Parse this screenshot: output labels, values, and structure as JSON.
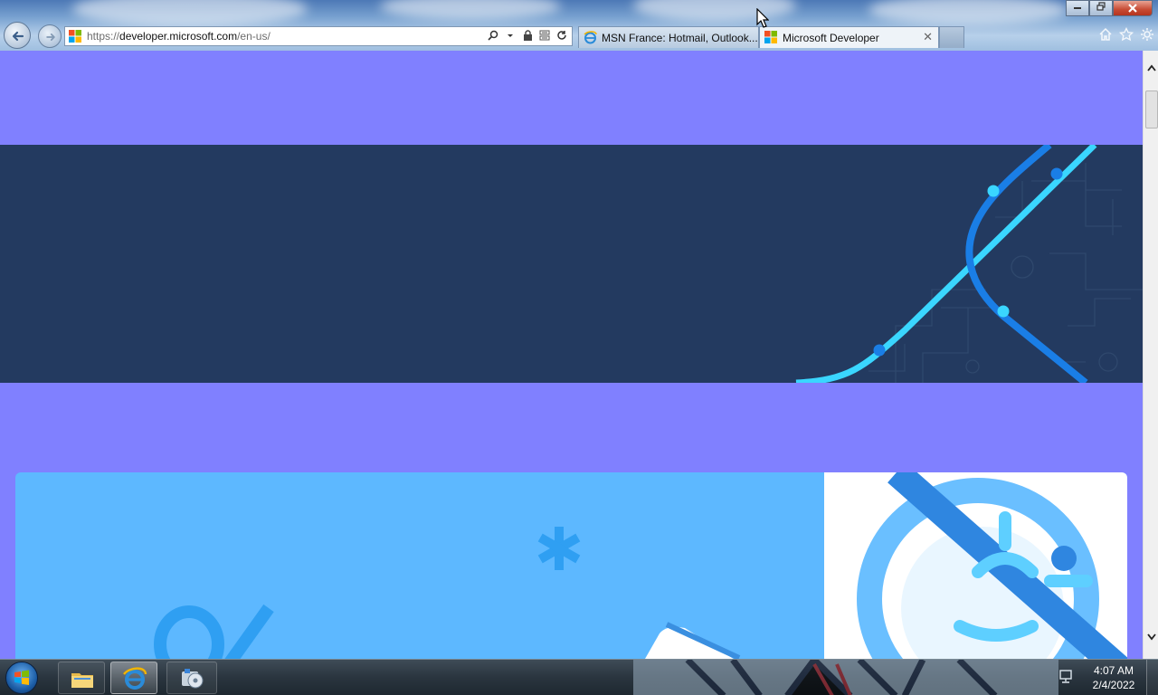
{
  "browser": {
    "url_prefix": "https://",
    "url_host": "developer.microsoft.com",
    "url_path": "/en-us/",
    "tabs": [
      {
        "label": "MSN France: Hotmail, Outlook...",
        "active": false,
        "icon": "ie-icon"
      },
      {
        "label": "Microsoft Developer",
        "active": true,
        "icon": "microsoft-logo-icon"
      }
    ],
    "close_tab_glyph": "✕",
    "address_tools": [
      "search-icon",
      "dropdown-icon",
      "lock-icon",
      "compatibility-icon",
      "refresh-icon"
    ],
    "right_icons": [
      "home-icon",
      "favorites-star-icon",
      "gear-icon"
    ]
  },
  "page": {
    "background_color": "#8080ff",
    "hero_color": "#233a60",
    "card_color": "#5db8ff",
    "hero_line_colors": [
      "#3ad6ff",
      "#1a7ee6"
    ]
  },
  "taskbar": {
    "items": [
      "start-button",
      "file-explorer",
      "internet-explorer",
      "media-app"
    ],
    "time": "4:07 AM",
    "date": "2/4/2022"
  }
}
